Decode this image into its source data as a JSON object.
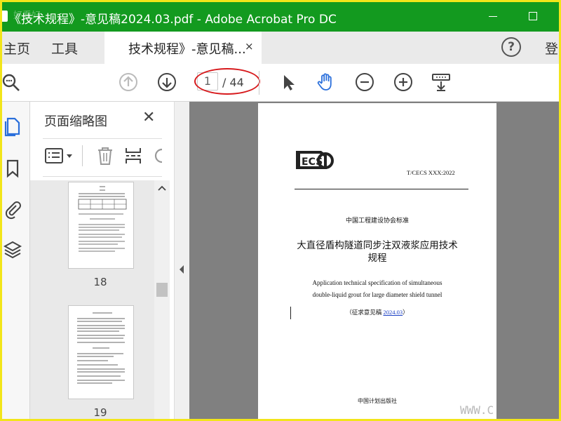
{
  "window": {
    "title": "《技术规程》-意见稿2024.03.pdf - Adobe Acrobat Pro DC",
    "watermark": "好看好"
  },
  "menu": {
    "home": "主页",
    "tools": "工具",
    "login": "登"
  },
  "tab": {
    "label": "技术规程》-意见稿...",
    "close": "×"
  },
  "help": {
    "symbol": "?"
  },
  "toolbar": {
    "page_current": "1",
    "page_total": "/ 44"
  },
  "sidebar": {
    "title": "页面缩略图",
    "close": "✕"
  },
  "thumbnails": [
    {
      "page": "18"
    },
    {
      "page": "19"
    }
  ],
  "document": {
    "standard_code": "T/CECS XXX:2022",
    "association": "中国工程建设协会标准",
    "title_cn": "大直径盾构隧道同步注双液浆应用技术规程",
    "title_en_line1": "Application technical specification of simultaneous",
    "title_en_line2": "double-liquid grout for large diameter shield tunnel",
    "draft_prefix": "（征求意见稿 ",
    "draft_date": "2024.03",
    "draft_suffix": "）",
    "publisher": "中国计划出版社",
    "logo_text": "ECS"
  },
  "site_watermark": "WWW.C",
  "colors": {
    "titlebar": "#139a1f",
    "frame": "#f2e51a",
    "annotation": "#d7191c",
    "accent": "#2a6fdb"
  }
}
